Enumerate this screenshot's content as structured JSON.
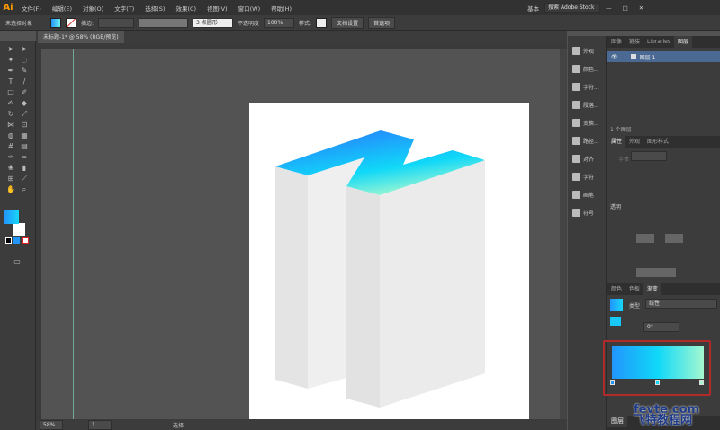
{
  "app": {
    "logo": "Ai",
    "workspace": "基本",
    "search_placeholder": "搜索 Adobe Stock"
  },
  "menu": [
    "文件(F)",
    "编辑(E)",
    "对象(O)",
    "文字(T)",
    "选择(S)",
    "效果(C)",
    "视图(V)",
    "窗口(W)",
    "帮助(H)"
  ],
  "control": {
    "selection": "未选择对象",
    "stroke_label": "描边:",
    "brush": "3 点圆形",
    "opacity_label": "不透明度",
    "opacity": "100%",
    "style_label": "样式:",
    "doc_setup": "文档设置",
    "prefs": "首选项"
  },
  "document": {
    "tab": "未标题-1* @ 58% (RGB/预览)",
    "zoom": "58%",
    "artboard": "1",
    "status": "选择"
  },
  "dock": [
    "外观",
    "颜色...",
    "字符...",
    "段落...",
    "变换...",
    "路径...",
    "对齐",
    "字符",
    "画笔",
    "符号"
  ],
  "layers": {
    "tabs": [
      "图像",
      "链接",
      "Libraries",
      "图层"
    ],
    "layer_name": "图层 1",
    "count": "1 个图层"
  },
  "props": {
    "tabs": [
      "属性",
      "外观",
      "图形样式"
    ],
    "font_label": "字体",
    "section": "透明"
  },
  "gradient": {
    "tabs": [
      "颜色",
      "色板",
      "渐变"
    ],
    "type_label": "类型",
    "type": "线性",
    "angle": "0°",
    "stops": [
      "#2196fc",
      "#10d8f8",
      "#a4f8d0"
    ]
  },
  "bottom_tab": "图层",
  "watermark": {
    "line1": "fevte.com",
    "line2": "飞特教程网"
  }
}
